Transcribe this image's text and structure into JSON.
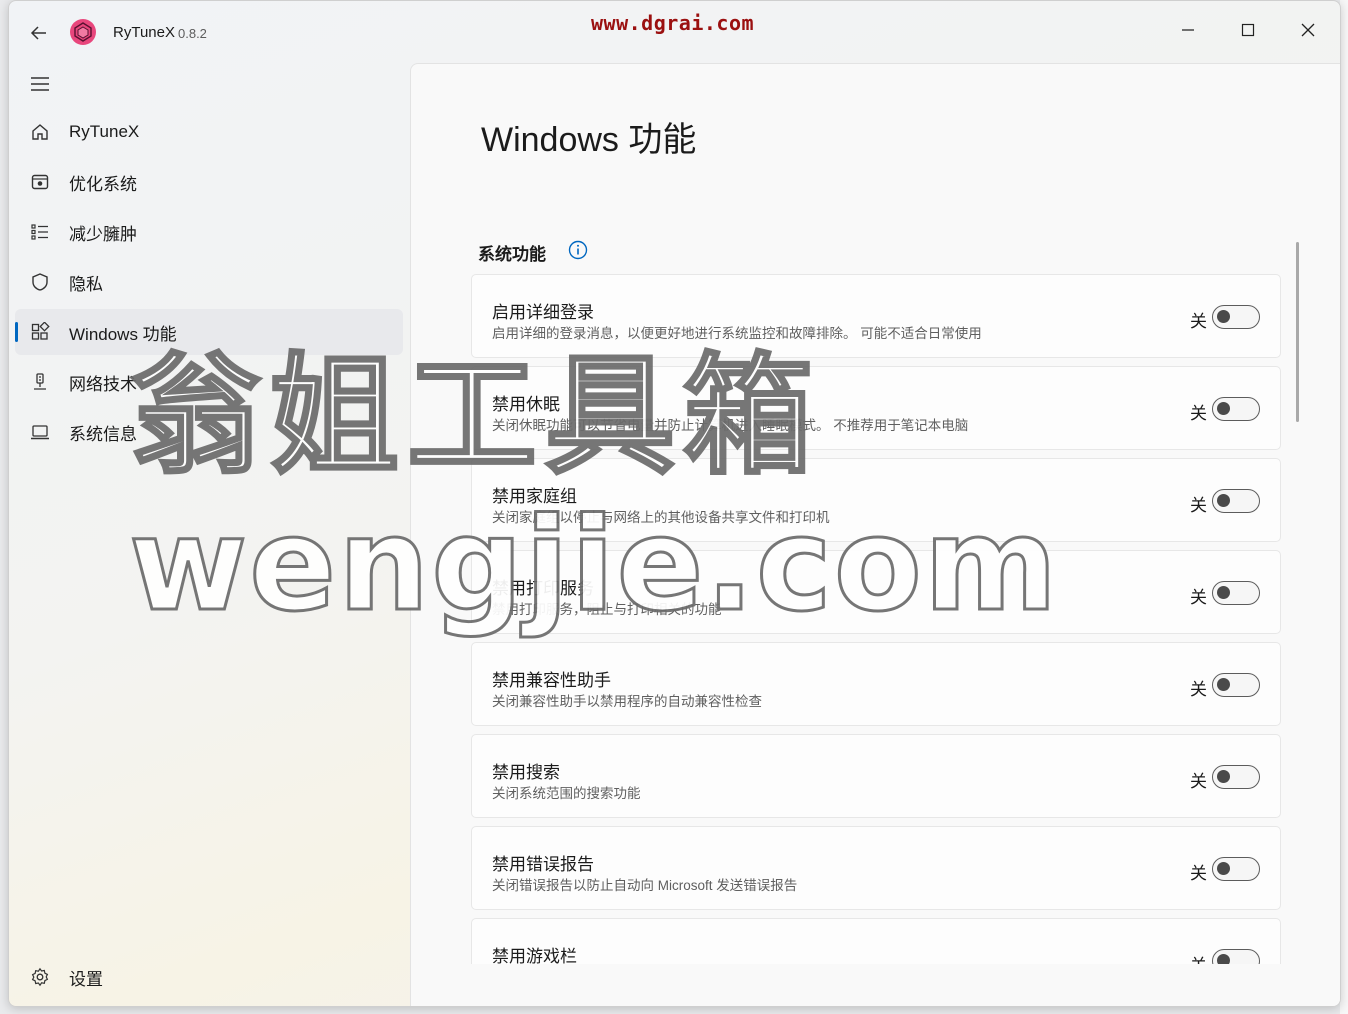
{
  "window": {
    "app_name": "RyTuneX",
    "version": "0.8.2",
    "site_watermark": "www.dgrai.com"
  },
  "sidebar": {
    "items": [
      {
        "label": "RyTuneX",
        "icon": "home-icon"
      },
      {
        "label": "优化系统",
        "icon": "optimize-icon"
      },
      {
        "label": "减少臃肿",
        "icon": "list-icon"
      },
      {
        "label": "隐私",
        "icon": "shield-icon"
      },
      {
        "label": "Windows 功能",
        "icon": "apps-icon"
      },
      {
        "label": "网络技术",
        "icon": "network-icon"
      },
      {
        "label": "系统信息",
        "icon": "laptop-icon"
      }
    ],
    "active_index": 4,
    "settings_label": "设置"
  },
  "main": {
    "page_title": "Windows 功能",
    "section_title": "系统功能",
    "features": [
      {
        "title": "启用详细登录",
        "description": "启用详细的登录消息，以便更好地进行系统监控和故障排除。 可能不适合日常使用",
        "state": "关",
        "on": false
      },
      {
        "title": "禁用休眠",
        "description": "关闭休眠功能可以节省电量并防止计算机进入睡眠模式。 不推荐用于笔记本电脑",
        "state": "关",
        "on": false
      },
      {
        "title": "禁用家庭组",
        "description": "关闭家庭组以停止与网络上的其他设备共享文件和打印机",
        "state": "关",
        "on": false
      },
      {
        "title": "禁用打印服务",
        "description": "禁用打印服务，阻止与打印相关的功能",
        "state": "关",
        "on": false
      },
      {
        "title": "禁用兼容性助手",
        "description": "关闭兼容性助手以禁用程序的自动兼容性检查",
        "state": "关",
        "on": false
      },
      {
        "title": "禁用搜索",
        "description": "关闭系统范围的搜索功能",
        "state": "关",
        "on": false
      },
      {
        "title": "禁用错误报告",
        "description": "关闭错误报告以防止自动向 Microsoft 发送错误报告",
        "state": "关",
        "on": false
      },
      {
        "title": "禁用游戏栏",
        "description": "",
        "state": "关",
        "on": false
      }
    ]
  },
  "overlay_watermarks": {
    "chinese": "翁姐工具箱",
    "english": "wengjie.com"
  },
  "colors": {
    "accent": "#0067c0",
    "watermark_red": "#9b1010"
  }
}
